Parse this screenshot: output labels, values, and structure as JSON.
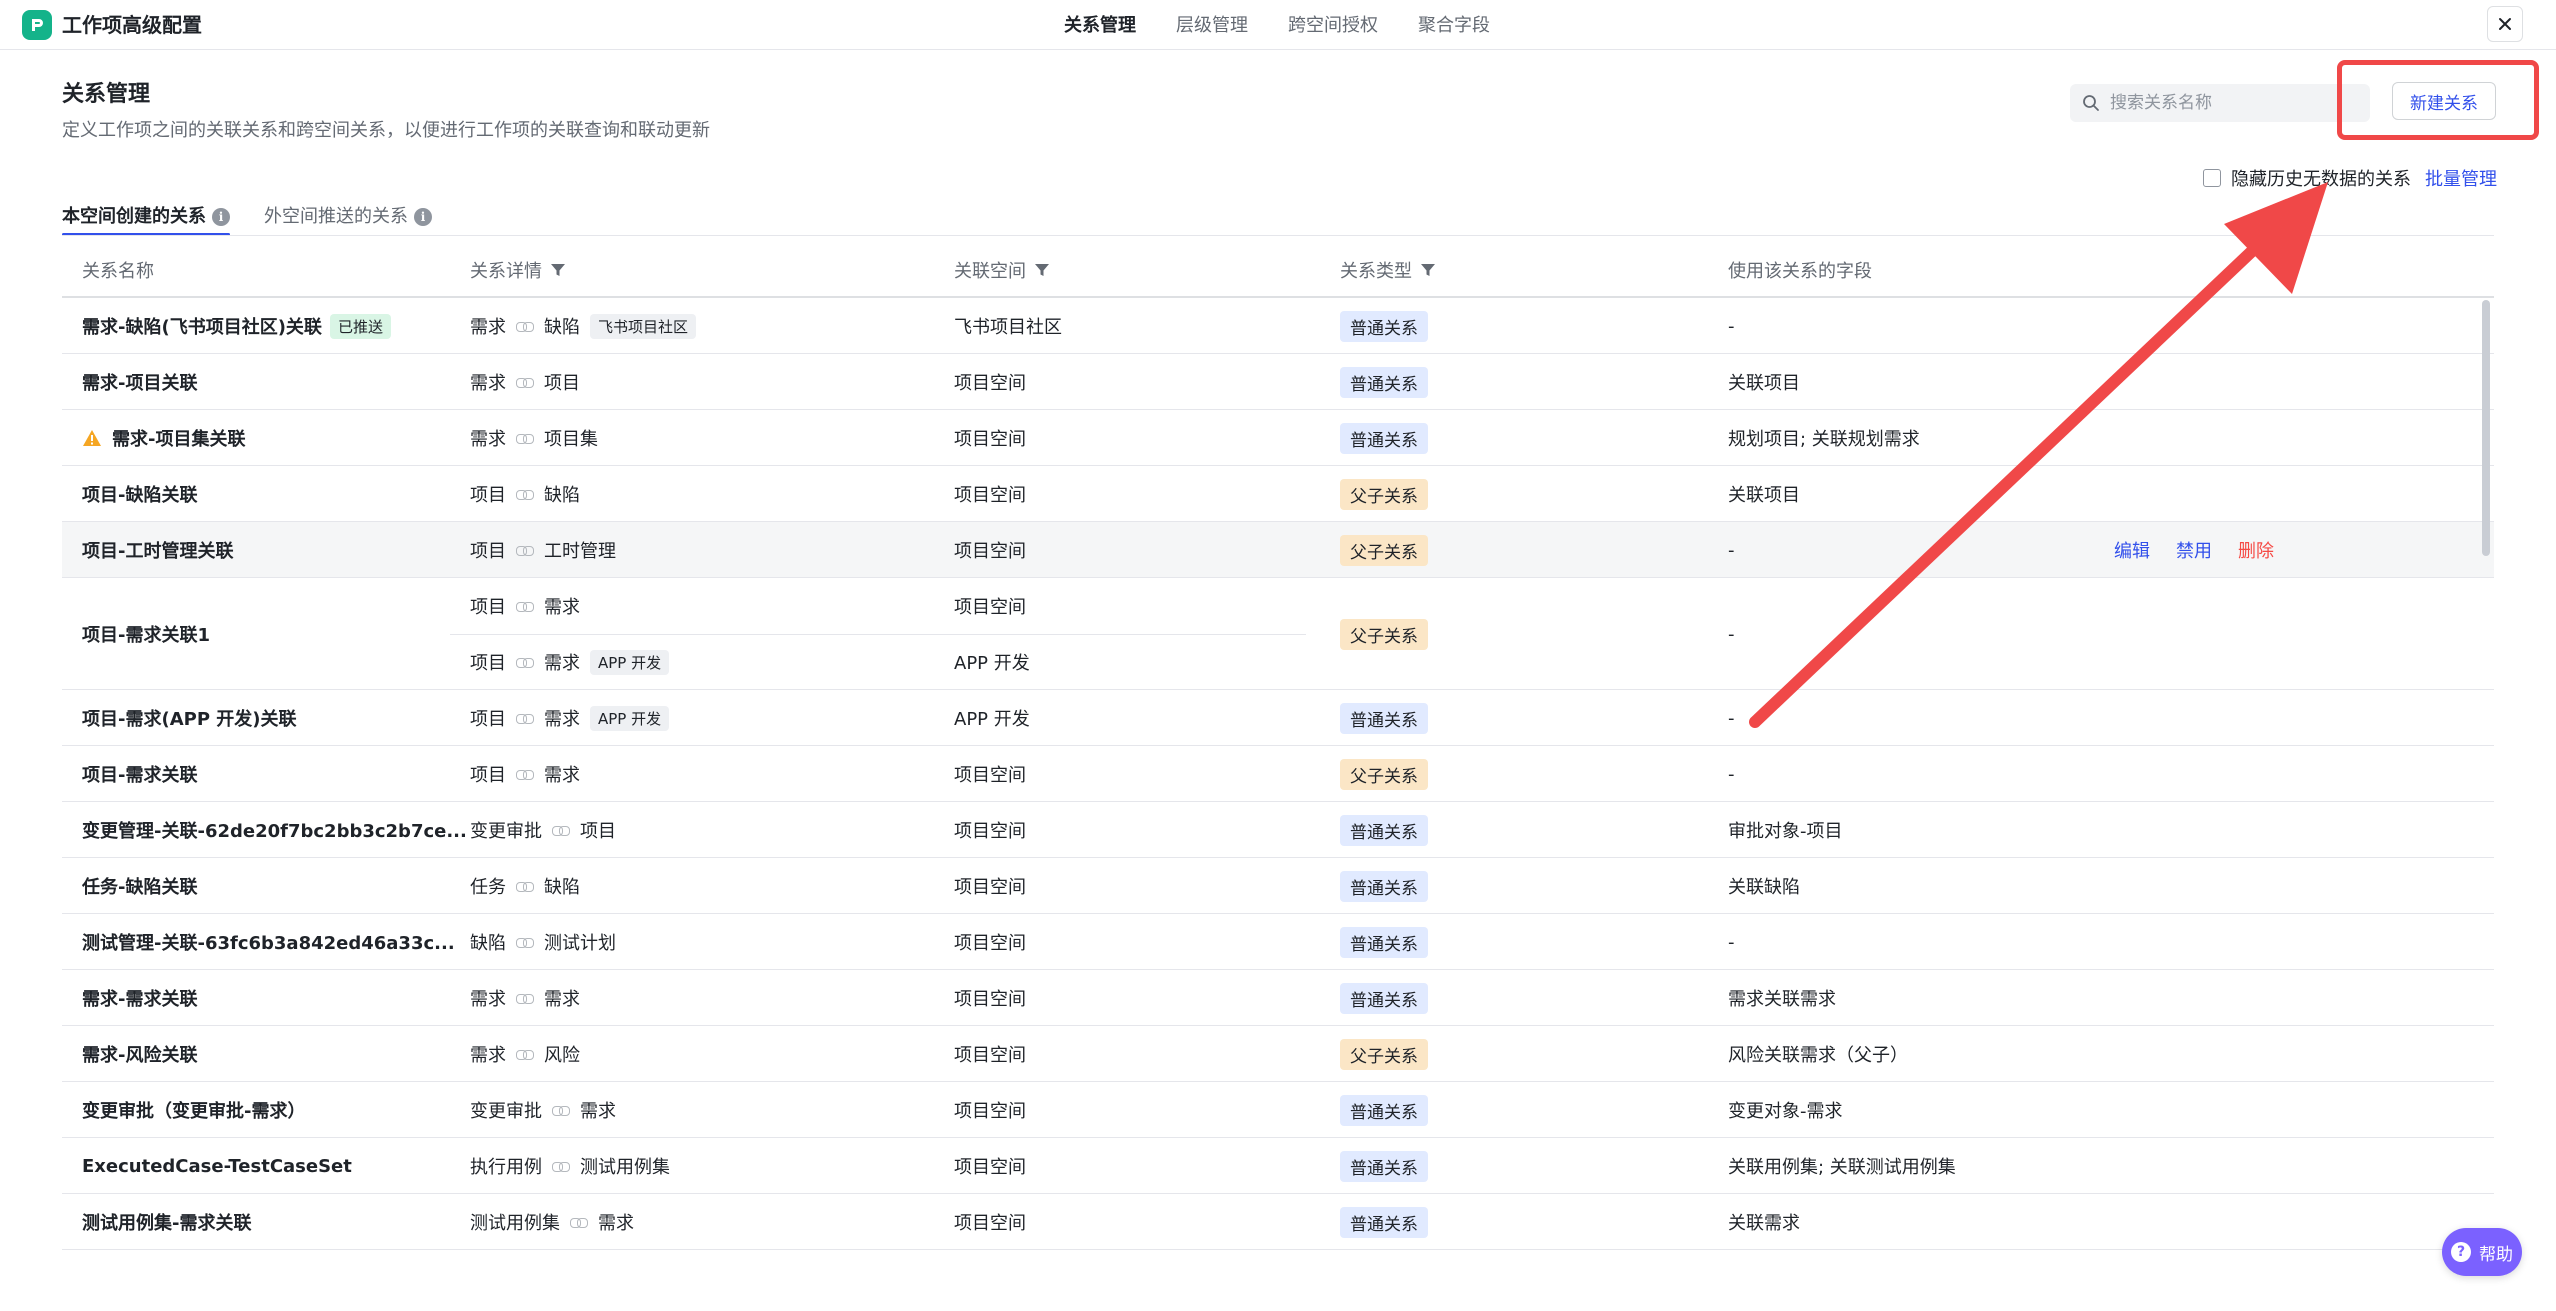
{
  "app": {
    "title": "工作项高级配置"
  },
  "nav": [
    {
      "label": "关系管理",
      "active": true
    },
    {
      "label": "层级管理",
      "active": false
    },
    {
      "label": "跨空间授权",
      "active": false
    },
    {
      "label": "聚合字段",
      "active": false
    }
  ],
  "section": {
    "title": "关系管理",
    "description": "定义工作项之间的关联关系和跨空间关系，以便进行工作项的关联查询和联动更新"
  },
  "search": {
    "placeholder": "搜索关系名称"
  },
  "new_button": "新建关系",
  "hide_history": {
    "label": "隐藏历史无数据的关系",
    "checked": false
  },
  "batch_manage": "批量管理",
  "tabs": [
    {
      "label": "本空间创建的关系",
      "active": true
    },
    {
      "label": "外空间推送的关系",
      "active": false
    }
  ],
  "columns": {
    "name": "关系名称",
    "detail": "关系详情",
    "space": "关联空间",
    "type": "关系类型",
    "fields": "使用该关系的字段"
  },
  "rows": [
    {
      "name": "需求-缺陷(飞书项目社区)关联",
      "pushed": "已推送",
      "from": "需求",
      "to": "缺陷",
      "to_tag": "飞书项目社区",
      "space": "飞书项目社区",
      "type": "普通关系",
      "fields": "-"
    },
    {
      "name": "需求-项目关联",
      "from": "需求",
      "to": "项目",
      "space": "项目空间",
      "type": "普通关系",
      "fields": "关联项目"
    },
    {
      "name": "需求-项目集关联",
      "warning": true,
      "from": "需求",
      "to": "项目集",
      "space": "项目空间",
      "type": "普通关系",
      "fields": "规划项目; 关联规划需求"
    },
    {
      "name": "项目-缺陷关联",
      "from": "项目",
      "to": "缺陷",
      "space": "项目空间",
      "type": "父子关系",
      "fields": "关联项目"
    },
    {
      "name": "项目-工时管理关联",
      "from": "项目",
      "to": "工时管理",
      "space": "项目空间",
      "type": "父子关系",
      "fields": "-",
      "hover": true
    },
    {
      "name": "项目-需求关联1",
      "from": "项目",
      "to": "需求",
      "space": "项目空间",
      "from2": "项目",
      "to2": "需求",
      "to2_tag": "APP 开发",
      "space2": "APP 开发",
      "type": "父子关系",
      "fields": "-"
    },
    {
      "name": "项目-需求(APP 开发)关联",
      "from": "项目",
      "to": "需求",
      "to_tag": "APP 开发",
      "space": "APP 开发",
      "type": "普通关系",
      "fields": "-"
    },
    {
      "name": "项目-需求关联",
      "from": "项目",
      "to": "需求",
      "space": "项目空间",
      "type": "父子关系",
      "fields": "-"
    },
    {
      "name": "变更管理-关联-62de20f7bc2bb3c2b7ce...",
      "from": "变更审批",
      "to": "项目",
      "space": "项目空间",
      "type": "普通关系",
      "fields": "审批对象-项目"
    },
    {
      "name": "任务-缺陷关联",
      "from": "任务",
      "to": "缺陷",
      "space": "项目空间",
      "type": "普通关系",
      "fields": "关联缺陷"
    },
    {
      "name": "测试管理-关联-63fc6b3a842ed46a33c...",
      "from": "缺陷",
      "to": "测试计划",
      "space": "项目空间",
      "type": "普通关系",
      "fields": "-"
    },
    {
      "name": "需求-需求关联",
      "from": "需求",
      "to": "需求",
      "space": "项目空间",
      "type": "普通关系",
      "fields": "需求关联需求"
    },
    {
      "name": "需求-风险关联",
      "from": "需求",
      "to": "风险",
      "space": "项目空间",
      "type": "父子关系",
      "fields": "风险关联需求（父子）"
    },
    {
      "name": "变更审批（变更审批-需求）",
      "from": "变更审批",
      "to": "需求",
      "space": "项目空间",
      "type": "普通关系",
      "fields": "变更对象-需求"
    },
    {
      "name": "ExecutedCase-TestCaseSet",
      "from": "执行用例",
      "to": "测试用例集",
      "space": "项目空间",
      "type": "普通关系",
      "fields": "关联用例集; 关联测试用例集"
    },
    {
      "name": "测试用例集-需求关联",
      "from": "测试用例集",
      "to": "需求",
      "space": "项目空间",
      "type": "普通关系",
      "fields": "关联需求"
    }
  ],
  "row_actions": {
    "edit": "编辑",
    "disable": "禁用",
    "delete": "删除"
  },
  "help": "帮助",
  "colors": {
    "accent": "#3250eb",
    "annotation": "#f04848",
    "brand": "#14b38a"
  }
}
